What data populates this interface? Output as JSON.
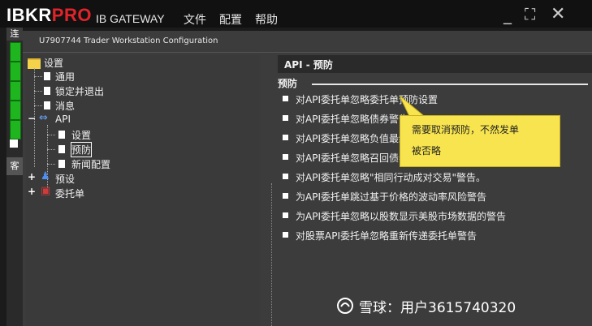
{
  "titlebar": {
    "logo_ibkr": "IBKR",
    "logo_pro": "PRO",
    "app_name": "IB GATEWAY",
    "menu": [
      "文件",
      "配置",
      "帮助"
    ]
  },
  "leftstrip": {
    "top_label": "连",
    "tab_label": "客"
  },
  "dialog": {
    "title": "U7907744 Trader Workstation Configuration"
  },
  "tree": {
    "root": "设置",
    "items": [
      "通用",
      "锁定并退出",
      "消息",
      "API",
      "设置",
      "预防",
      "新闻配置",
      "预设",
      "委托单"
    ]
  },
  "panel": {
    "header": "API - 预防",
    "section": "预防",
    "options": [
      "对API委托单忽略委托单预防设置",
      "对API委托单忽略债券警告",
      "对API委托单忽略负值最终",
      "对API委托单忽略召回债券",
      "对API委托单忽略\"相同行动成对交易\"警告。",
      "为API委托单跳过基于价格的波动率风险警告",
      "为API委托单忽略以股数显示美股市场数据的警告",
      "对股票API委托单忽略重新传递委托单警告"
    ]
  },
  "callout": {
    "line1": "需要取消预防，不然发单",
    "line2": "被否略"
  },
  "watermark": {
    "text": "雪球：用户3615740320"
  },
  "colors": {
    "logo_pro": "#e0242a",
    "status_green": "#1eb51e",
    "callout_bg": "#f7e44e"
  }
}
